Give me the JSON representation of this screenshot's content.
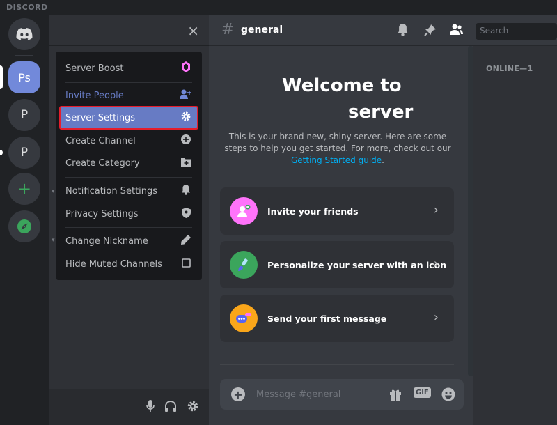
{
  "app": {
    "brand": "DISCORD"
  },
  "servers": [
    {
      "label": "",
      "icon": "discord-logo-icon"
    },
    {
      "label": "Ps"
    },
    {
      "label": "P"
    },
    {
      "label": "P"
    },
    {
      "label": "+",
      "icon": "plus-icon"
    },
    {
      "label": "",
      "icon": "compass-icon"
    }
  ],
  "channel_sidebar": {
    "close_glyph": "×"
  },
  "context_menu": {
    "items": [
      {
        "label": "Server Boost",
        "icon": "boost-gem-icon"
      },
      {
        "label": "Invite People",
        "icon": "add-person-icon"
      },
      {
        "label": "Server Settings",
        "icon": "gear-icon",
        "selected": true
      },
      {
        "label": "Create Channel",
        "icon": "plus-circle-icon"
      },
      {
        "label": "Create Category",
        "icon": "folder-plus-icon"
      },
      {
        "label": "Notification Settings",
        "icon": "bell-icon"
      },
      {
        "label": "Privacy Settings",
        "icon": "shield-icon"
      },
      {
        "label": "Change Nickname",
        "icon": "pencil-icon"
      },
      {
        "label": "Hide Muted Channels",
        "icon": "checkbox-icon"
      }
    ]
  },
  "channel": {
    "hash": "#",
    "name": "general"
  },
  "search": {
    "placeholder": "Search"
  },
  "welcome": {
    "title_line1": "Welcome to",
    "title_line2": "server",
    "description": "This is your brand new, shiny server. Here are some steps to help you get started. For more, check out our",
    "link_text": "Getting Started guide",
    "after_link": "."
  },
  "cards": [
    {
      "label": "Invite your friends",
      "icon": "invite-friends-icon"
    },
    {
      "label": "Personalize your server with an icon",
      "icon": "brush-icon"
    },
    {
      "label": "Send your first message",
      "icon": "chat-bubble-icon"
    }
  ],
  "composer": {
    "placeholder": "Message #general",
    "gif_label": "GIF"
  },
  "members": {
    "online_header": "ONLINE—1"
  },
  "colors": {
    "blurple": "#7289da",
    "selected_outline": "#e51d2c",
    "link": "#00b0f4",
    "green": "#3ba55c"
  }
}
